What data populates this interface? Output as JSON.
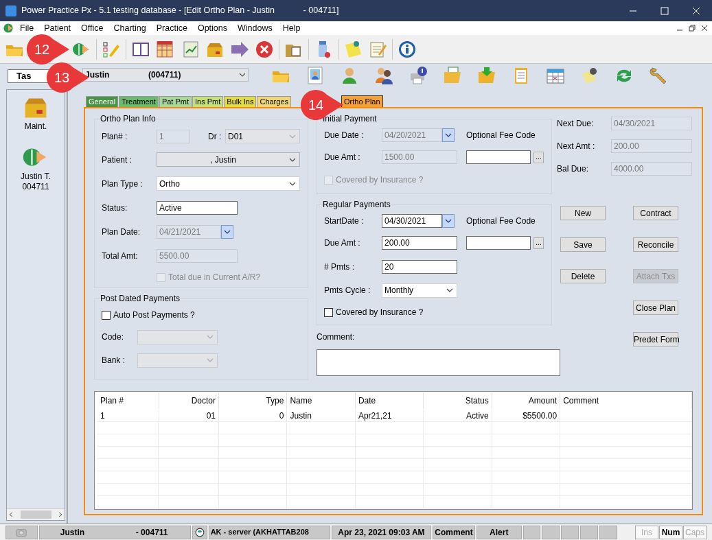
{
  "window": {
    "title": "Power Practice Px - 5.1 testing database - [Edit Ortho Plan - Justin            - 004711]"
  },
  "menu": [
    "File",
    "Patient",
    "Office",
    "Charting",
    "Practice",
    "Options",
    "Windows",
    "Help"
  ],
  "callouts": [
    "12",
    "13",
    "14"
  ],
  "sidebar": {
    "header": "Tas",
    "items": [
      {
        "kind": "maintenance",
        "lines": [
          "Maint."
        ]
      },
      {
        "kind": "patient",
        "lines": [
          "Justin T.",
          "004711"
        ]
      }
    ]
  },
  "patient_selector": {
    "name": "Justin",
    "id": "(004711)"
  },
  "tabs": [
    {
      "label": "General",
      "color": "#4a944a",
      "selected": false
    },
    {
      "label": "Treatment",
      "color": "#6cba6c",
      "selected": false
    },
    {
      "label": "Pat Pmt",
      "color": "#a8d898",
      "selected": false
    },
    {
      "label": "Ins Pmt",
      "color": "#c4e07c",
      "selected": false
    },
    {
      "label": "Bulk Ins",
      "color": "#e2dc44",
      "selected": false
    },
    {
      "label": "Charges",
      "color": "#f0d67a",
      "selected": false
    },
    {
      "label": "Ortho Plan",
      "color": "#f4a238",
      "selected": true
    }
  ],
  "ortho_plan_info": {
    "title": "Ortho Plan Info",
    "plan_number": {
      "label": "Plan# :",
      "value": "1",
      "disabled": true
    },
    "doctor": {
      "label": "Dr :",
      "value": "D01",
      "disabled": true
    },
    "patient": {
      "label": "Patient :",
      "value": ", Justin",
      "disabled": true
    },
    "plan_type": {
      "label": "Plan Type :",
      "value": "Ortho",
      "disabled": false
    },
    "status": {
      "label": "Status:",
      "value": "Active",
      "disabled": false
    },
    "plan_date": {
      "label": "Plan Date:",
      "value": "04/21/2021",
      "disabled": true
    },
    "total_amt": {
      "label": "Total Amt:",
      "value": "5500.00",
      "disabled": true
    },
    "total_due": {
      "label": "Total due in Current A/R?",
      "checked": false,
      "disabled": true
    }
  },
  "post_dated_payments": {
    "title": "Post Dated Payments",
    "auto_post": {
      "label": "Auto Post Payments ?",
      "checked": false,
      "disabled": false
    },
    "code": {
      "label": "Code:",
      "disabled": true
    },
    "bank": {
      "label": "Bank :",
      "disabled": true
    }
  },
  "initial_payment": {
    "title": "Initial Payment",
    "due_date": {
      "label": "Due Date :",
      "value": "04/20/2021",
      "disabled": true
    },
    "fee_code": {
      "label": "Optional Fee Code",
      "button": "..."
    },
    "due_amt": {
      "label": "Due Amt :",
      "value": "1500.00",
      "disabled": true
    },
    "covered": {
      "label": "Covered by Insurance ?",
      "checked": false,
      "disabled": true
    }
  },
  "regular_payments": {
    "title": "Regular Payments",
    "start_date": {
      "label": "StartDate :",
      "value": "04/30/2021",
      "disabled": false
    },
    "fee_code": {
      "label": "Optional Fee Code",
      "button": "..."
    },
    "due_amt": {
      "label": "Due Amt :",
      "value": "200.00",
      "disabled": false
    },
    "num_pmts": {
      "label": "# Pmts :",
      "value": "20",
      "disabled": false
    },
    "pmts_cycle": {
      "label": "Pmts Cycle :",
      "value": "Monthly",
      "disabled": false
    },
    "covered": {
      "label": "Covered by Insurance ?",
      "checked": false,
      "disabled": false
    }
  },
  "comment": {
    "label": "Comment:"
  },
  "summary": [
    {
      "label": "Next Due:",
      "value": "04/30/2021"
    },
    {
      "label": "Next Amt :",
      "value": "200.00"
    },
    {
      "label": "Bal Due:",
      "value": "4000.00"
    }
  ],
  "left_buttons": [
    {
      "label": "New",
      "disabled": false
    },
    {
      "label": "Save",
      "disabled": false
    },
    {
      "label": "Delete",
      "disabled": false
    }
  ],
  "right_buttons": [
    {
      "label": "Contract",
      "disabled": false
    },
    {
      "label": "Reconcile",
      "disabled": false
    },
    {
      "label": "Attach Txs",
      "disabled": true
    },
    {
      "label": "Close Plan",
      "disabled": false
    },
    {
      "label": "Predet Form",
      "disabled": false
    }
  ],
  "table": {
    "columns": [
      "Plan #",
      "Doctor",
      "Type",
      "Name",
      "Date",
      "Status",
      "Amount",
      "Comment"
    ],
    "rows": [
      {
        "cells": [
          "1",
          "01",
          "0",
          "Justin",
          "Apr21,21",
          "Active",
          "$5500.00"
        ]
      }
    ]
  },
  "status_bar": {
    "patient": "Justin",
    "patient_id": "- 004711",
    "server": "AK - server (AKHATTAB208",
    "datetime": "Apr 23, 2021 09:03 AM",
    "comment": "Comment",
    "alert": "Alert",
    "keys": [
      {
        "label": "Ins",
        "on": false
      },
      {
        "label": "Num",
        "on": true
      },
      {
        "label": "Caps",
        "on": false
      }
    ]
  }
}
